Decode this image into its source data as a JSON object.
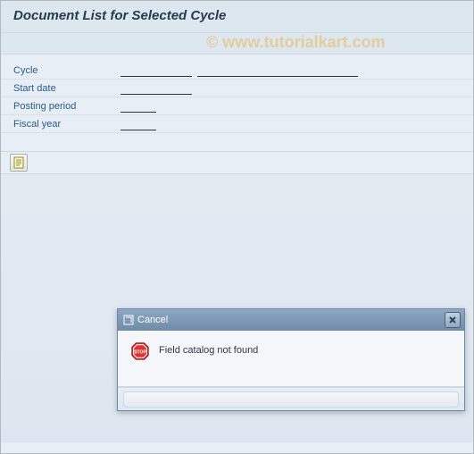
{
  "header": {
    "title": "Document List for Selected Cycle"
  },
  "watermark": "© www.tutorialkart.com",
  "form": {
    "cycle": {
      "label": "Cycle",
      "value1": "",
      "value2": ""
    },
    "start_date": {
      "label": "Start date",
      "value": ""
    },
    "posting_period": {
      "label": "Posting period",
      "value": ""
    },
    "fiscal_year": {
      "label": "Fiscal year",
      "value": ""
    }
  },
  "panel": {
    "display_icon_name": "display-document-icon"
  },
  "dialog": {
    "title": "Cancel",
    "message": "Field catalog not found"
  }
}
